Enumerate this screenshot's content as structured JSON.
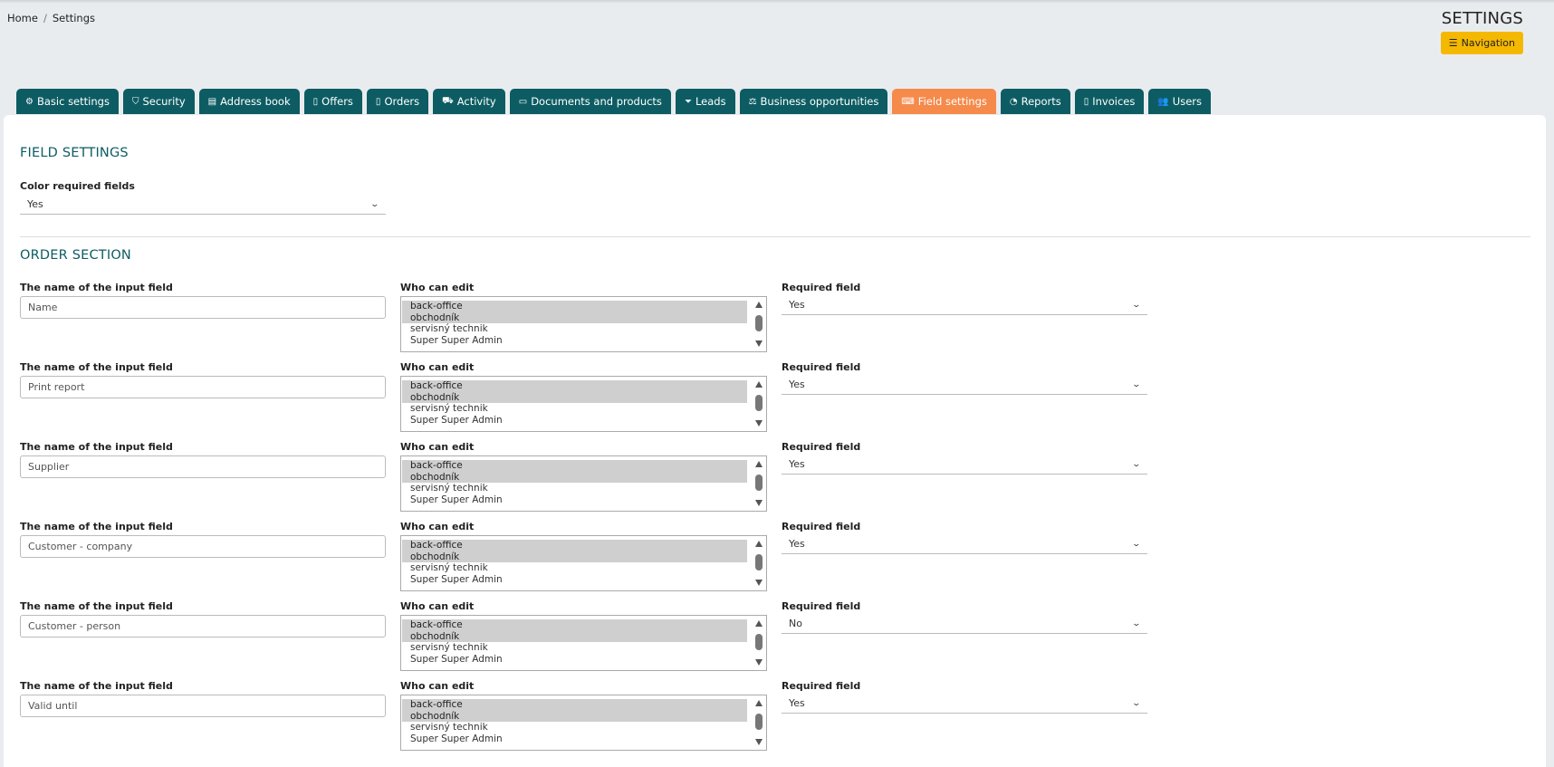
{
  "breadcrumb": {
    "home": "Home",
    "separator": "/",
    "current": "Settings"
  },
  "header": {
    "title": "SETTINGS",
    "navigation_label": "Navigation"
  },
  "tabs": [
    {
      "label": "Basic settings",
      "icon": "gears-icon"
    },
    {
      "label": "Security",
      "icon": "shield-icon"
    },
    {
      "label": "Address book",
      "icon": "address-card-icon"
    },
    {
      "label": "Offers",
      "icon": "file-icon"
    },
    {
      "label": "Orders",
      "icon": "file-icon"
    },
    {
      "label": "Activity",
      "icon": "truck-icon"
    },
    {
      "label": "Documents and products",
      "icon": "folder-open-icon"
    },
    {
      "label": "Leads",
      "icon": "funnel-icon"
    },
    {
      "label": "Business opportunities",
      "icon": "balance-scale-icon"
    },
    {
      "label": "Field settings",
      "icon": "keyboard-icon",
      "active": true
    },
    {
      "label": "Reports",
      "icon": "pie-chart-icon"
    },
    {
      "label": "Invoices",
      "icon": "file-icon"
    },
    {
      "label": "Users",
      "icon": "users-icon"
    }
  ],
  "field_settings": {
    "title": "FIELD SETTINGS",
    "color_required_label": "Color required fields",
    "color_required_value": "Yes"
  },
  "order_section": {
    "title": "ORDER SECTION",
    "name_label": "The name of the input field",
    "who_label": "Who can edit",
    "required_label": "Required field",
    "who_options": [
      "back-office",
      "obchodník",
      "servisný technik",
      "Super Super Admin"
    ],
    "rows": [
      {
        "name": "Name",
        "required": "Yes"
      },
      {
        "name": "Print report",
        "required": "Yes"
      },
      {
        "name": "Supplier",
        "required": "Yes"
      },
      {
        "name": "Customer - company",
        "required": "Yes"
      },
      {
        "name": "Customer - person",
        "required": "No"
      },
      {
        "name": "Valid until",
        "required": "Yes"
      }
    ]
  },
  "colors": {
    "tab": "#0d5c63",
    "tab_active": "#f58a4b",
    "nav_button": "#f5b800",
    "section_title": "#0d5c63"
  }
}
